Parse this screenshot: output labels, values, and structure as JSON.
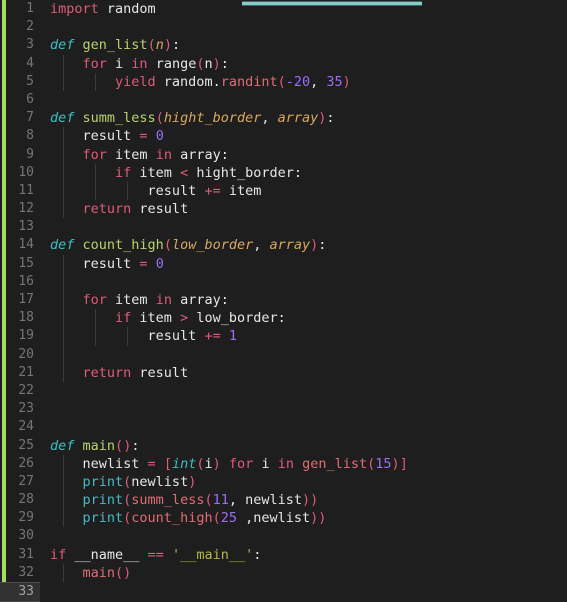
{
  "editor": {
    "title": "python-code-editor",
    "language": "Python",
    "theme_background": "#1e1e1e",
    "accent_bar_color": "#8fc7c4",
    "vcs_stripe_color": "#a0e05a",
    "current_line": 33,
    "total_lines": 33,
    "line_numbers": [
      1,
      2,
      3,
      4,
      5,
      6,
      7,
      8,
      9,
      10,
      11,
      12,
      13,
      14,
      15,
      16,
      17,
      18,
      19,
      20,
      21,
      22,
      23,
      24,
      25,
      26,
      27,
      28,
      29,
      30,
      31,
      32,
      33
    ]
  },
  "code": {
    "lines": [
      {
        "n": 1,
        "text": "import random",
        "guides": 0
      },
      {
        "n": 2,
        "text": "",
        "guides": 0
      },
      {
        "n": 3,
        "text": "def gen_list(n):",
        "guides": 0
      },
      {
        "n": 4,
        "text": "    for i in range(n):",
        "guides": 1
      },
      {
        "n": 5,
        "text": "        yield random.randint(-20, 35)",
        "guides": 2
      },
      {
        "n": 6,
        "text": "",
        "guides": 0
      },
      {
        "n": 7,
        "text": "def summ_less(hight_border, array):",
        "guides": 0
      },
      {
        "n": 8,
        "text": "    result = 0",
        "guides": 1
      },
      {
        "n": 9,
        "text": "    for item in array:",
        "guides": 1
      },
      {
        "n": 10,
        "text": "        if item < hight_border:",
        "guides": 2
      },
      {
        "n": 11,
        "text": "            result += item",
        "guides": 3
      },
      {
        "n": 12,
        "text": "    return result",
        "guides": 1
      },
      {
        "n": 13,
        "text": "",
        "guides": 0
      },
      {
        "n": 14,
        "text": "def count_high(low_border, array):",
        "guides": 0
      },
      {
        "n": 15,
        "text": "    result = 0",
        "guides": 1
      },
      {
        "n": 16,
        "text": "",
        "guides": 1
      },
      {
        "n": 17,
        "text": "    for item in array:",
        "guides": 1
      },
      {
        "n": 18,
        "text": "        if item > low_border:",
        "guides": 2
      },
      {
        "n": 19,
        "text": "            result += 1",
        "guides": 3
      },
      {
        "n": 20,
        "text": "",
        "guides": 1
      },
      {
        "n": 21,
        "text": "    return result",
        "guides": 1
      },
      {
        "n": 22,
        "text": "",
        "guides": 0
      },
      {
        "n": 23,
        "text": "",
        "guides": 0
      },
      {
        "n": 24,
        "text": "",
        "guides": 0
      },
      {
        "n": 25,
        "text": "def main():",
        "guides": 0
      },
      {
        "n": 26,
        "text": "    newlist = [int(i) for i in gen_list(15)]",
        "guides": 1
      },
      {
        "n": 27,
        "text": "    print(newlist)",
        "guides": 1
      },
      {
        "n": 28,
        "text": "    print(summ_less(11, newlist))",
        "guides": 1
      },
      {
        "n": 29,
        "text": "    print(count_high(25 ,newlist))",
        "guides": 1
      },
      {
        "n": 30,
        "text": "",
        "guides": 0
      },
      {
        "n": 31,
        "text": "if __name__ == '__main__':",
        "guides": 0
      },
      {
        "n": 32,
        "text": "    main()",
        "guides": 1
      },
      {
        "n": 33,
        "text": "",
        "guides": 0
      }
    ],
    "tokens": {
      "l1": [
        {
          "t": "import",
          "c": "kw"
        },
        {
          "t": " random",
          "c": "txt"
        }
      ],
      "l3": [
        {
          "t": "def",
          "c": "kw-def"
        },
        {
          "t": " ",
          "c": "txt"
        },
        {
          "t": "gen_list",
          "c": "fn"
        },
        {
          "t": "(",
          "c": "op"
        },
        {
          "t": "n",
          "c": "param"
        },
        {
          "t": ")",
          "c": "op"
        },
        {
          "t": ":",
          "c": "txt"
        }
      ],
      "l4": [
        {
          "t": "    ",
          "c": "txt"
        },
        {
          "t": "for",
          "c": "kw"
        },
        {
          "t": " i ",
          "c": "txt"
        },
        {
          "t": "in",
          "c": "kw"
        },
        {
          "t": " range",
          "c": "txt"
        },
        {
          "t": "(",
          "c": "op"
        },
        {
          "t": "n",
          "c": "txt"
        },
        {
          "t": ")",
          "c": "op"
        },
        {
          "t": ":",
          "c": "txt"
        }
      ],
      "l5": [
        {
          "t": "        ",
          "c": "txt"
        },
        {
          "t": "yield",
          "c": "kw"
        },
        {
          "t": " random.",
          "c": "txt"
        },
        {
          "t": "randint",
          "c": "attr"
        },
        {
          "t": "(",
          "c": "op"
        },
        {
          "t": "-20",
          "c": "num"
        },
        {
          "t": ", ",
          "c": "txt"
        },
        {
          "t": "35",
          "c": "num"
        },
        {
          "t": ")",
          "c": "op"
        }
      ],
      "l7": [
        {
          "t": "def",
          "c": "kw-def"
        },
        {
          "t": " ",
          "c": "txt"
        },
        {
          "t": "summ_less",
          "c": "fn"
        },
        {
          "t": "(",
          "c": "op"
        },
        {
          "t": "hight_border",
          "c": "param"
        },
        {
          "t": ", ",
          "c": "txt"
        },
        {
          "t": "array",
          "c": "param"
        },
        {
          "t": ")",
          "c": "op"
        },
        {
          "t": ":",
          "c": "txt"
        }
      ],
      "l8": [
        {
          "t": "    result ",
          "c": "txt"
        },
        {
          "t": "=",
          "c": "op"
        },
        {
          "t": " ",
          "c": "txt"
        },
        {
          "t": "0",
          "c": "num"
        }
      ],
      "l9": [
        {
          "t": "    ",
          "c": "txt"
        },
        {
          "t": "for",
          "c": "kw"
        },
        {
          "t": " item ",
          "c": "txt"
        },
        {
          "t": "in",
          "c": "kw"
        },
        {
          "t": " array:",
          "c": "txt"
        }
      ],
      "l10": [
        {
          "t": "        ",
          "c": "txt"
        },
        {
          "t": "if",
          "c": "kw"
        },
        {
          "t": " item ",
          "c": "txt"
        },
        {
          "t": "<",
          "c": "op"
        },
        {
          "t": " hight_border:",
          "c": "txt"
        }
      ],
      "l11": [
        {
          "t": "            result ",
          "c": "txt"
        },
        {
          "t": "+=",
          "c": "op"
        },
        {
          "t": " item",
          "c": "txt"
        }
      ],
      "l12": [
        {
          "t": "    ",
          "c": "txt"
        },
        {
          "t": "return",
          "c": "kw"
        },
        {
          "t": " result",
          "c": "txt"
        }
      ],
      "l14": [
        {
          "t": "def",
          "c": "kw-def"
        },
        {
          "t": " ",
          "c": "txt"
        },
        {
          "t": "count_high",
          "c": "fn"
        },
        {
          "t": "(",
          "c": "op"
        },
        {
          "t": "low_border",
          "c": "param"
        },
        {
          "t": ", ",
          "c": "txt"
        },
        {
          "t": "array",
          "c": "param"
        },
        {
          "t": ")",
          "c": "op"
        },
        {
          "t": ":",
          "c": "txt"
        }
      ],
      "l15": [
        {
          "t": "    result ",
          "c": "txt"
        },
        {
          "t": "=",
          "c": "op"
        },
        {
          "t": " ",
          "c": "txt"
        },
        {
          "t": "0",
          "c": "num"
        }
      ],
      "l17": [
        {
          "t": "    ",
          "c": "txt"
        },
        {
          "t": "for",
          "c": "kw"
        },
        {
          "t": " item ",
          "c": "txt"
        },
        {
          "t": "in",
          "c": "kw"
        },
        {
          "t": " array:",
          "c": "txt"
        }
      ],
      "l18": [
        {
          "t": "        ",
          "c": "txt"
        },
        {
          "t": "if",
          "c": "kw"
        },
        {
          "t": " item ",
          "c": "txt"
        },
        {
          "t": ">",
          "c": "op"
        },
        {
          "t": " low_border:",
          "c": "txt"
        }
      ],
      "l19": [
        {
          "t": "            result ",
          "c": "txt"
        },
        {
          "t": "+=",
          "c": "op"
        },
        {
          "t": " ",
          "c": "txt"
        },
        {
          "t": "1",
          "c": "num"
        }
      ],
      "l21": [
        {
          "t": "    ",
          "c": "txt"
        },
        {
          "t": "return",
          "c": "kw"
        },
        {
          "t": " result",
          "c": "txt"
        }
      ],
      "l25": [
        {
          "t": "def",
          "c": "kw-def"
        },
        {
          "t": " ",
          "c": "txt"
        },
        {
          "t": "main",
          "c": "fn"
        },
        {
          "t": "(",
          "c": "op"
        },
        {
          "t": ")",
          "c": "op"
        },
        {
          "t": ":",
          "c": "txt"
        }
      ],
      "l26": [
        {
          "t": "    newlist ",
          "c": "txt"
        },
        {
          "t": "=",
          "c": "op"
        },
        {
          "t": " ",
          "c": "txt"
        },
        {
          "t": "[",
          "c": "op"
        },
        {
          "t": "int",
          "c": "kw-def"
        },
        {
          "t": "(",
          "c": "op"
        },
        {
          "t": "i",
          "c": "txt"
        },
        {
          "t": ")",
          "c": "op"
        },
        {
          "t": " ",
          "c": "txt"
        },
        {
          "t": "for",
          "c": "kw"
        },
        {
          "t": " i ",
          "c": "txt"
        },
        {
          "t": "in",
          "c": "kw"
        },
        {
          "t": " ",
          "c": "txt"
        },
        {
          "t": "gen_list",
          "c": "call"
        },
        {
          "t": "(",
          "c": "op"
        },
        {
          "t": "15",
          "c": "num"
        },
        {
          "t": ")",
          "c": "op"
        },
        {
          "t": "]",
          "c": "op"
        }
      ],
      "l27": [
        {
          "t": "    ",
          "c": "txt"
        },
        {
          "t": "print",
          "c": "builtin"
        },
        {
          "t": "(",
          "c": "op"
        },
        {
          "t": "newlist",
          "c": "txt"
        },
        {
          "t": ")",
          "c": "op"
        }
      ],
      "l28": [
        {
          "t": "    ",
          "c": "txt"
        },
        {
          "t": "print",
          "c": "builtin"
        },
        {
          "t": "(",
          "c": "op"
        },
        {
          "t": "summ_less",
          "c": "call"
        },
        {
          "t": "(",
          "c": "op"
        },
        {
          "t": "11",
          "c": "num"
        },
        {
          "t": ", newlist",
          "c": "txt"
        },
        {
          "t": ")",
          "c": "op"
        },
        {
          "t": ")",
          "c": "op"
        }
      ],
      "l29": [
        {
          "t": "    ",
          "c": "txt"
        },
        {
          "t": "print",
          "c": "builtin"
        },
        {
          "t": "(",
          "c": "op"
        },
        {
          "t": "count_high",
          "c": "call"
        },
        {
          "t": "(",
          "c": "op"
        },
        {
          "t": "25",
          "c": "num"
        },
        {
          "t": " ,newlist",
          "c": "txt"
        },
        {
          "t": ")",
          "c": "op"
        },
        {
          "t": ")",
          "c": "op"
        }
      ],
      "l31": [
        {
          "t": "if",
          "c": "kw"
        },
        {
          "t": " __name__ ",
          "c": "txt"
        },
        {
          "t": "==",
          "c": "op"
        },
        {
          "t": " ",
          "c": "txt"
        },
        {
          "t": "'__main__'",
          "c": "str"
        },
        {
          "t": ":",
          "c": "txt"
        }
      ],
      "l32": [
        {
          "t": "    ",
          "c": "txt"
        },
        {
          "t": "main",
          "c": "call"
        },
        {
          "t": "(",
          "c": "op"
        },
        {
          "t": ")",
          "c": "op"
        }
      ]
    }
  }
}
